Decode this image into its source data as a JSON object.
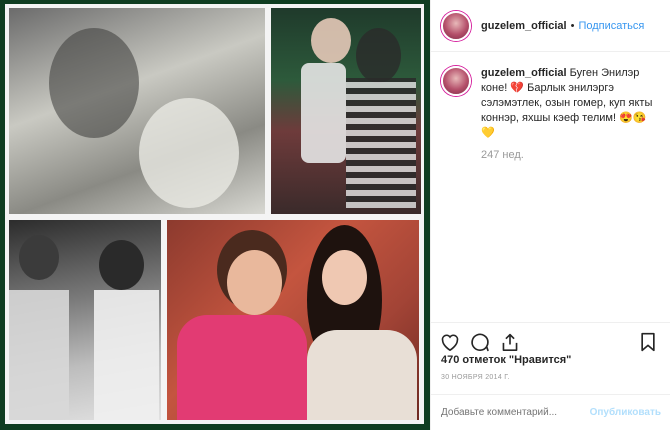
{
  "post": {
    "username": "guzelem_official",
    "separator": "•",
    "follow_label": "Подписаться"
  },
  "caption": {
    "username": "guzelem_official",
    "text": "Буген Энилэр коне! 💔 Барлык энилэргэ сэлэмэтлек, озын гомер, куп якты коннэр, яхшы кэеф телим! 😍😘💛",
    "ago": "247 нед."
  },
  "actions": {
    "like_icon": "heart-icon",
    "comment_icon": "comment-icon",
    "share_icon": "share-icon",
    "save_icon": "bookmark-icon"
  },
  "likes_text": "470 отметок \"Нравится\"",
  "date_text": "30 НОЯБРЯ 2014 Г.",
  "comment_box": {
    "placeholder": "Добавьте комментарий...",
    "publish_label": "Опубликовать"
  },
  "colors": {
    "accent": "#3897f0",
    "frame": "#0f3d21"
  }
}
